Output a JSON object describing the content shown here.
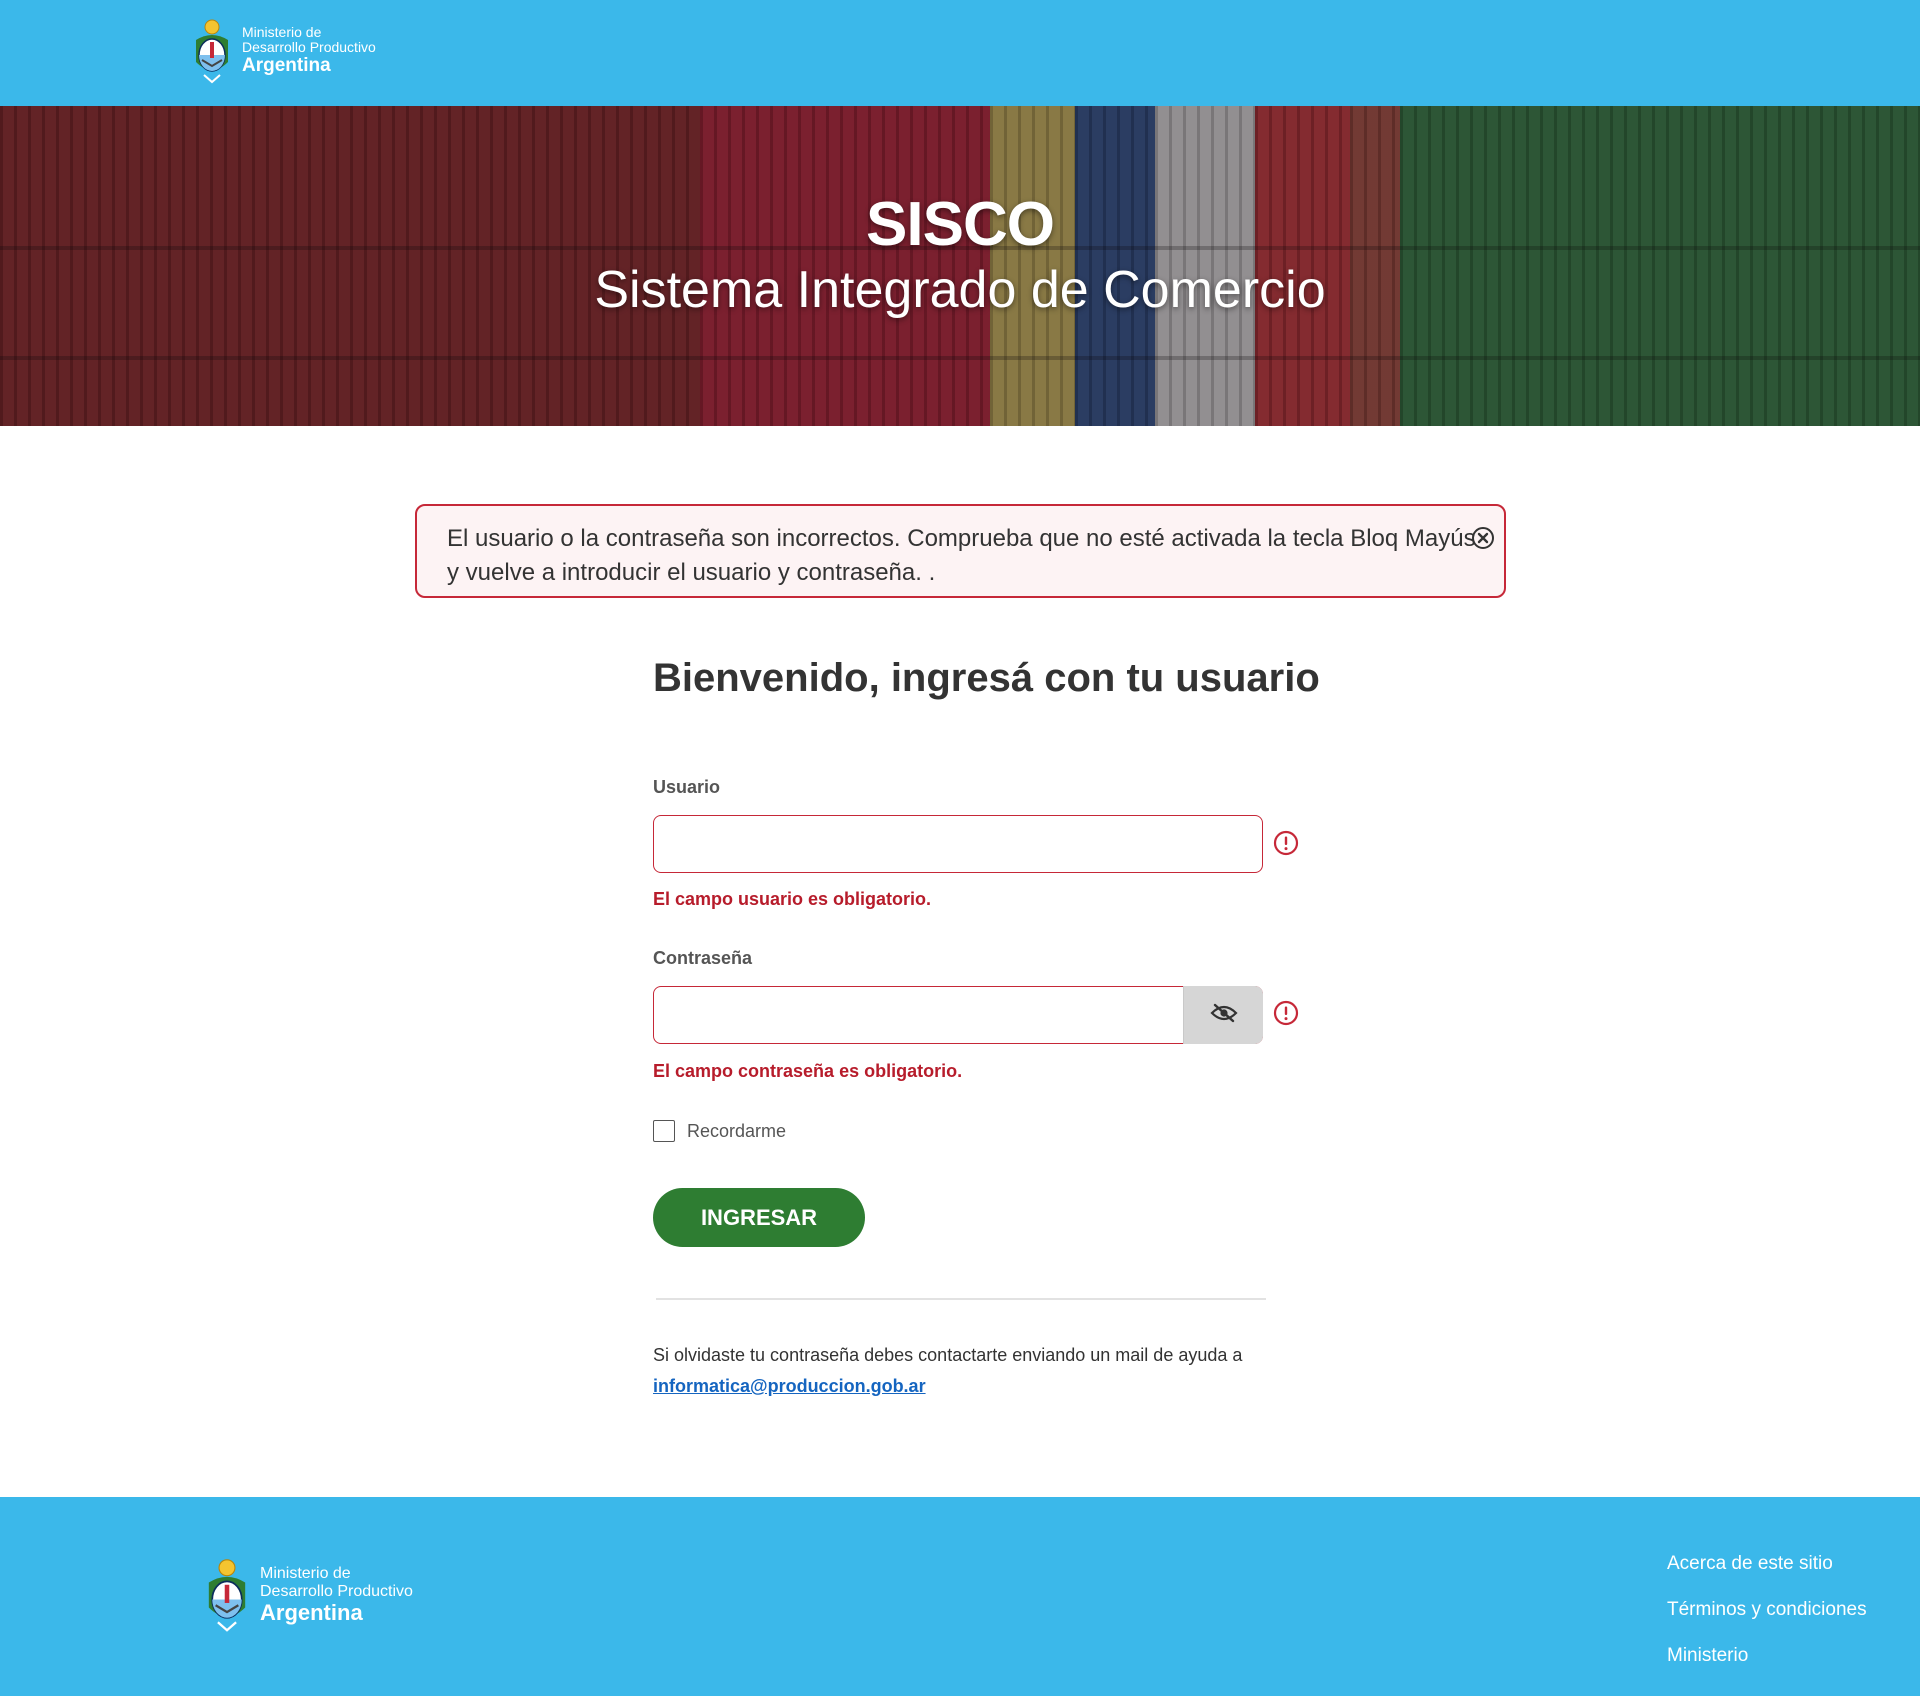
{
  "header": {
    "logo": {
      "line1": "Ministerio de",
      "line2": "Desarrollo Productivo",
      "line3": "Argentina"
    },
    "background_color": "#3bb8ea"
  },
  "hero": {
    "title": "SISCO",
    "subtitle": "Sistema Integrado de Comercio"
  },
  "alert": {
    "message": "El usuario o la contraseña son incorrectos. Comprueba que no esté activada la tecla Bloq Mayús y vuelve a introducir el usuario y contraseña. .",
    "close_icon": "close-circle-icon",
    "color": "#c62838"
  },
  "form": {
    "heading": "Bienvenido, ingresá con tu usuario",
    "username": {
      "label": "Usuario",
      "value": "",
      "error": "El campo usuario es obligatorio."
    },
    "password": {
      "label": "Contraseña",
      "value": "",
      "error": "El campo contraseña es obligatorio.",
      "toggle_icon": "eye-slash-icon"
    },
    "remember": {
      "label": "Recordarme",
      "checked": false
    },
    "submit_label": "INGRESAR",
    "submit_color": "#2e7d32",
    "error_icon": "exclamation-circle-icon",
    "help": {
      "text": "Si olvidaste tu contraseña debes contactarte enviando un mail de ayuda a",
      "email": "informatica@produccion.gob.ar"
    }
  },
  "footer": {
    "logo": {
      "line1": "Ministerio de",
      "line2": "Desarrollo Productivo",
      "line3": "Argentina"
    },
    "links": [
      "Acerca de este sitio",
      "Términos y condiciones",
      "Ministerio"
    ]
  }
}
